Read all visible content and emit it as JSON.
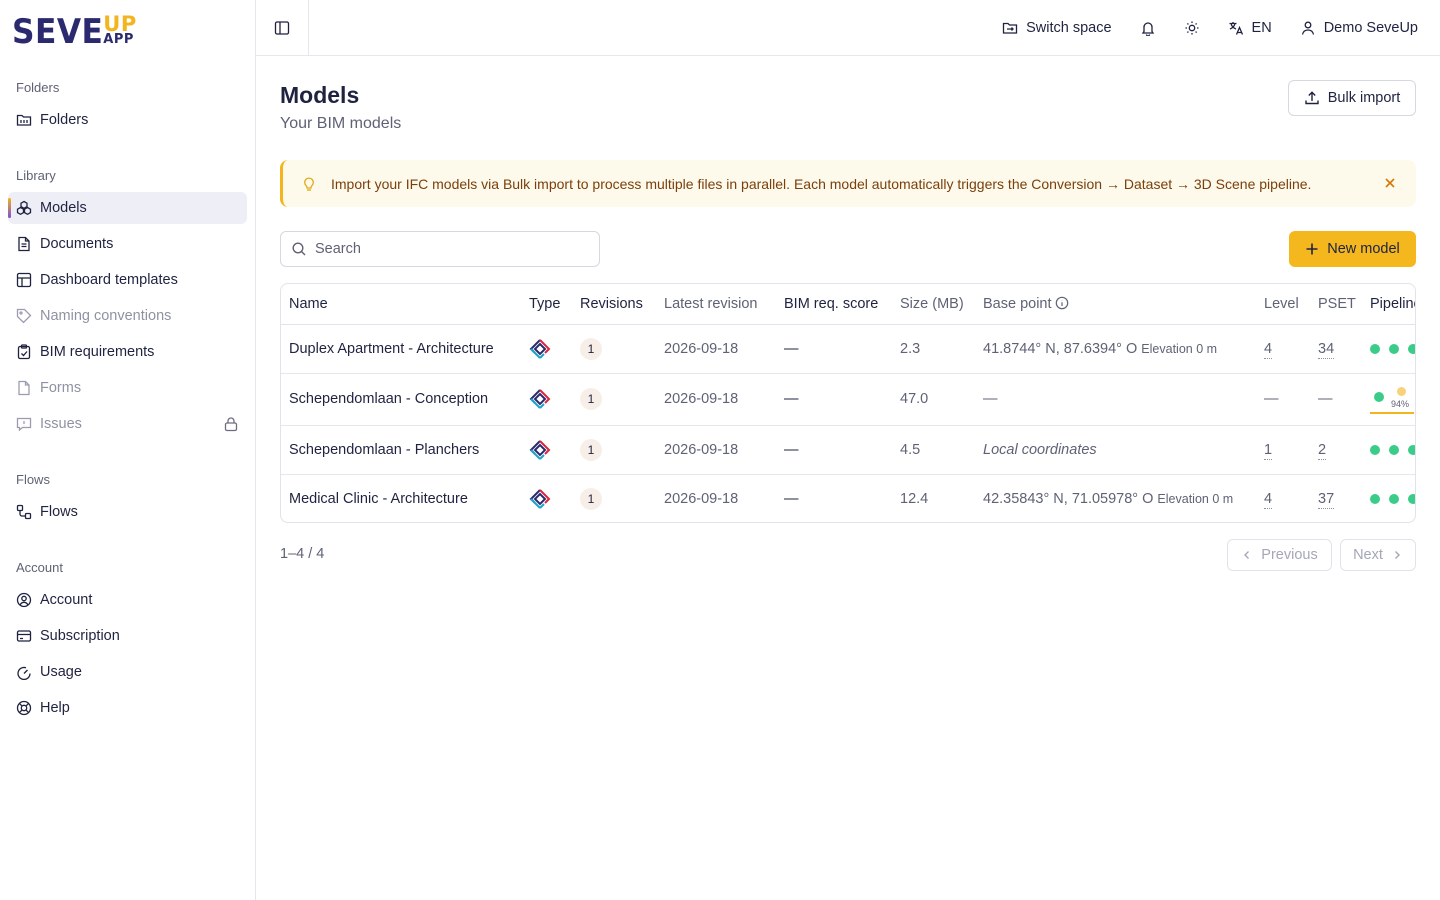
{
  "logo": {
    "main": "SEVE",
    "up": "UP",
    "app": "APP"
  },
  "sidebar": {
    "sections": [
      {
        "heading": "Folders",
        "items": [
          {
            "label": "Folders",
            "icon": "folder-icon"
          }
        ]
      },
      {
        "heading": "Library",
        "items": [
          {
            "label": "Models",
            "icon": "models-icon",
            "active": true
          },
          {
            "label": "Documents",
            "icon": "document-icon"
          },
          {
            "label": "Dashboard templates",
            "icon": "dashboard-icon"
          },
          {
            "label": "Naming conventions",
            "icon": "tag-icon",
            "disabled": true
          },
          {
            "label": "BIM requirements",
            "icon": "clipboard-icon"
          },
          {
            "label": "Forms",
            "icon": "form-icon",
            "disabled": true
          },
          {
            "label": "Issues",
            "icon": "message-icon",
            "disabled": true,
            "locked": true
          }
        ]
      },
      {
        "heading": "Flows",
        "items": [
          {
            "label": "Flows",
            "icon": "flows-icon"
          }
        ]
      },
      {
        "heading": "Account",
        "items": [
          {
            "label": "Account",
            "icon": "user-circle-icon"
          },
          {
            "label": "Subscription",
            "icon": "card-icon"
          },
          {
            "label": "Usage",
            "icon": "gauge-icon"
          },
          {
            "label": "Help",
            "icon": "lifebuoy-icon"
          }
        ]
      }
    ]
  },
  "topbar": {
    "switch_space": "Switch space",
    "language": "EN",
    "user": "Demo SeveUp"
  },
  "page": {
    "title": "Models",
    "subtitle": "Your BIM models",
    "bulk_import": "Bulk import",
    "alert": "Import your IFC models via Bulk import to process multiple files in parallel. Each model automatically triggers the Conversion → Dataset → 3D Scene pipeline.",
    "search_placeholder": "Search",
    "new_model": "New model"
  },
  "table": {
    "headers": {
      "name": "Name",
      "type": "Type",
      "revisions": "Revisions",
      "latest_revision": "Latest revision",
      "bim_score": "BIM req. score",
      "size": "Size (MB)",
      "base_point": "Base point",
      "level": "Level",
      "pset": "PSET",
      "pipeline": "Pipeline"
    },
    "rows": [
      {
        "name": "Duplex Apartment - Architecture",
        "revisions": "1",
        "latest": "2026-09-18",
        "score": "—",
        "size": "2.3",
        "base_point": "41.8744° N, 87.6394° O",
        "elevation": "Elevation 0 m",
        "level": "4",
        "pset": "34",
        "pipeline_dots": 3
      },
      {
        "name": "Schependomlaan - Conception",
        "revisions": "1",
        "latest": "2026-09-18",
        "score": "—",
        "size": "47.0",
        "base_point": "—",
        "elevation": "",
        "level": "—",
        "pset": "—",
        "pipeline_progress": "94%",
        "progress_value": 0.94
      },
      {
        "name": "Schependomlaan - Planchers",
        "revisions": "1",
        "latest": "2026-09-18",
        "score": "—",
        "size": "4.5",
        "base_point": "Local coordinates",
        "elevation": "",
        "level": "1",
        "pset": "2",
        "pipeline_dots": 3
      },
      {
        "name": "Medical Clinic - Architecture",
        "revisions": "1",
        "latest": "2026-09-18",
        "score": "—",
        "size": "12.4",
        "base_point": "42.35843° N, 71.05978° O",
        "elevation": "Elevation 0 m",
        "level": "4",
        "pset": "37",
        "pipeline_dots": 3
      }
    ]
  },
  "pagination": {
    "info": "1–4 / 4",
    "previous": "Previous",
    "next": "Next"
  },
  "colors": {
    "accent": "#f4b71e",
    "brand": "#2b2a6e",
    "success": "#3ccc8a"
  }
}
